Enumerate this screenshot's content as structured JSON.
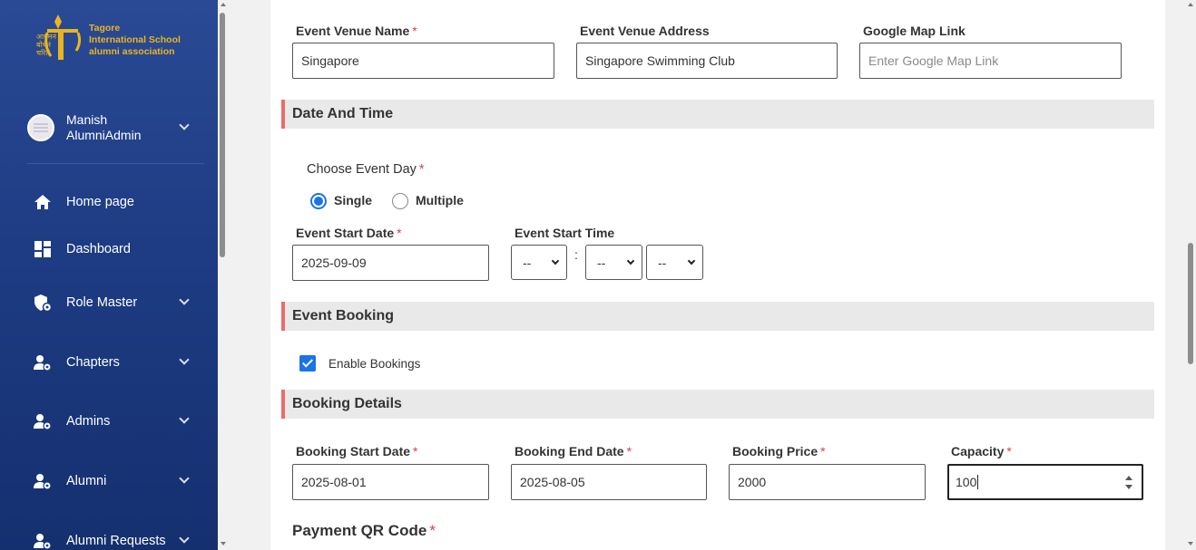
{
  "sidebar": {
    "logo_text_line1": "Tagore",
    "logo_text_line2": "International School",
    "logo_text_line3": "alumni association",
    "logo_script": [
      "आगमनं",
      "बोधनं",
      "चरितं"
    ],
    "user_name": "Manish AlumniAdmin",
    "items": [
      {
        "label": "Home page",
        "icon": "home-icon"
      },
      {
        "label": "Dashboard",
        "icon": "dashboard-icon"
      },
      {
        "label": "Role Master",
        "icon": "shield-gear-icon"
      },
      {
        "label": "Chapters",
        "icon": "user-gear-icon"
      },
      {
        "label": "Admins",
        "icon": "user-gear-icon"
      },
      {
        "label": "Alumni",
        "icon": "user-gear-icon"
      },
      {
        "label": "Alumni Requests",
        "icon": "user-gear-icon"
      }
    ]
  },
  "venue": {
    "name_label": "Event Venue Name",
    "name_value": "Singapore",
    "address_label": "Event Venue Address",
    "address_value": "Singapore Swimming Club",
    "map_label": "Google Map Link",
    "map_placeholder": "Enter Google Map Link"
  },
  "date_time": {
    "section_title": "Date And Time",
    "choose_day_label": "Choose Event Day",
    "option_single": "Single",
    "option_multiple": "Multiple",
    "selected": "Single",
    "start_date_label": "Event Start Date",
    "start_date_value": "2025-09-09",
    "start_time_label": "Event Start Time",
    "time_hour": "--",
    "time_minute": "--",
    "time_ampm": "--",
    "time_separator": ":"
  },
  "booking": {
    "section_title": "Event Booking",
    "enable_label": "Enable Bookings",
    "enabled": true
  },
  "booking_details": {
    "section_title": "Booking Details",
    "start_label": "Booking Start Date",
    "start_value": "2025-08-01",
    "end_label": "Booking End Date",
    "end_value": "2025-08-05",
    "price_label": "Booking Price",
    "price_value": "2000",
    "capacity_label": "Capacity",
    "capacity_value": "100",
    "qr_label": "Payment QR Code"
  },
  "required_mark": "*",
  "colors": {
    "sidebar": "#1e3c84",
    "accent": "#1a73e8",
    "section_border": "#ec6b6b",
    "logo": "#e9b51f",
    "required": "#e23b3b"
  }
}
